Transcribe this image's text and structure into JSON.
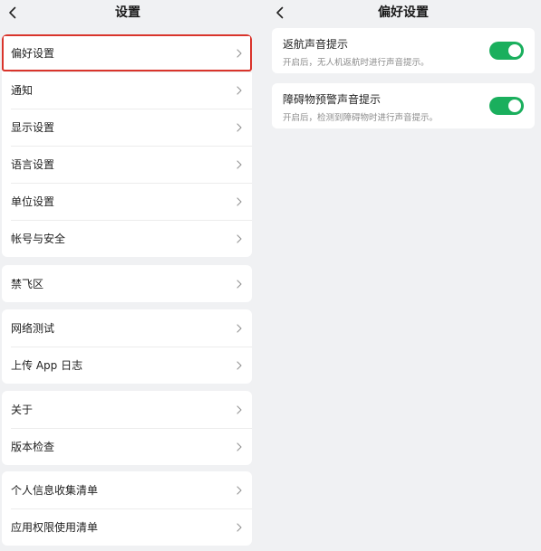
{
  "left": {
    "title": "设置",
    "groups": [
      {
        "items": [
          {
            "label": "偏好设置"
          },
          {
            "label": "通知"
          },
          {
            "label": "显示设置"
          },
          {
            "label": "语言设置"
          },
          {
            "label": "单位设置"
          },
          {
            "label": "帐号与安全"
          }
        ]
      },
      {
        "items": [
          {
            "label": "禁飞区"
          }
        ]
      },
      {
        "items": [
          {
            "label": "网络测试"
          },
          {
            "label": "上传 App 日志"
          }
        ]
      },
      {
        "items": [
          {
            "label": "关于"
          },
          {
            "label": "版本检查"
          }
        ]
      },
      {
        "items": [
          {
            "label": "个人信息收集清单"
          },
          {
            "label": "应用权限使用清单"
          }
        ]
      }
    ]
  },
  "right": {
    "title": "偏好设置",
    "toggles": [
      {
        "title": "返航声音提示",
        "desc": "开启后，无人机返航时进行声音提示。",
        "enabled": true
      },
      {
        "title": "障碍物预警声音提示",
        "desc": "开启后，检测到障碍物时进行声音提示。",
        "enabled": true
      }
    ]
  },
  "colors": {
    "toggle_on": "#1aaf5d",
    "highlight_border": "#d9342b",
    "background": "#f0f1f3"
  },
  "icons": {
    "back": "chevron-left-icon",
    "row_arrow": "chevron-right-icon"
  }
}
